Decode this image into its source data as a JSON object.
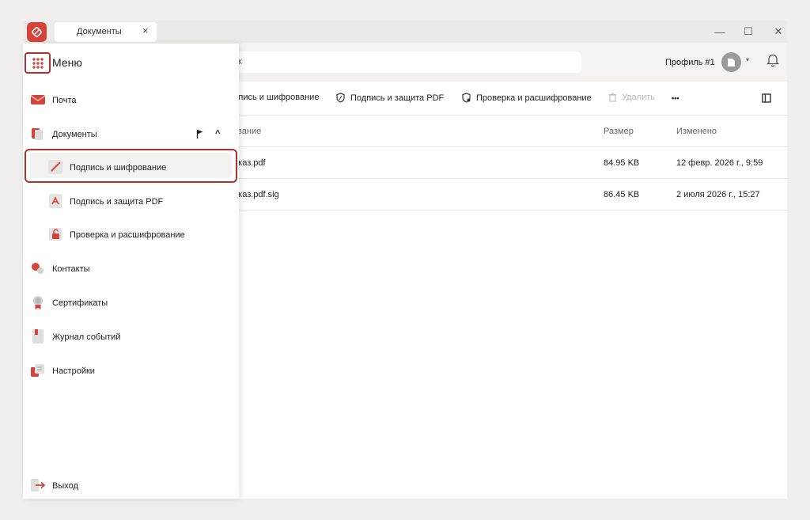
{
  "window": {
    "tab_label": "Документы",
    "tab_close": "×",
    "minimize": "—",
    "maximize": "☐",
    "close": "✕"
  },
  "header": {
    "search_placeholder": "к",
    "profile_label": "Профиль #1",
    "profile_caret": "▾"
  },
  "toolbar": {
    "sign_encrypt": "дпись и шифрование",
    "sign_pdf": "Подпись и защита PDF",
    "verify_decrypt": "Проверка и расшифрование",
    "delete": "Удалить",
    "more": "•••"
  },
  "table": {
    "columns": {
      "name": "звание",
      "size": "Размер",
      "modified": "Изменено"
    },
    "rows": [
      {
        "name": "иказ.pdf",
        "size": "84.95 KB",
        "modified": "12 февр. 2026 г., 9:59"
      },
      {
        "name": "иказ.pdf.sig",
        "size": "86.45 KB",
        "modified": "2 июля 2026 г., 15:27"
      }
    ]
  },
  "menu": {
    "title": "Меню",
    "items": [
      {
        "label": "Почта",
        "icon": "mail-icon"
      },
      {
        "label": "Документы",
        "icon": "documents-icon"
      },
      {
        "label": "Подпись и шифрование",
        "icon": "sign-encrypt-icon"
      },
      {
        "label": "Подпись и защита PDF",
        "icon": "pdf-icon"
      },
      {
        "label": "Проверка и расшифрование",
        "icon": "unlock-icon"
      },
      {
        "label": "Контакты",
        "icon": "contacts-icon"
      },
      {
        "label": "Сертификаты",
        "icon": "certificate-icon"
      },
      {
        "label": "Журнал событий",
        "icon": "journal-icon"
      },
      {
        "label": "Настройки",
        "icon": "settings-icon"
      },
      {
        "label": "Выход",
        "icon": "logout-icon"
      }
    ],
    "collapse_caret": "^"
  },
  "colors": {
    "accent": "#d6433a",
    "highlight_border": "#b2312b"
  }
}
